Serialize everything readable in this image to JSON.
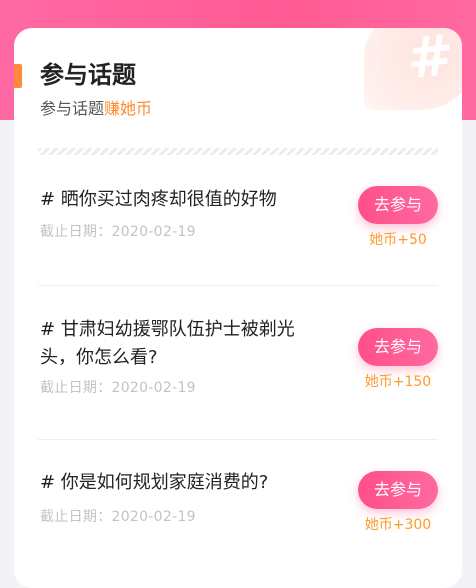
{
  "header": {
    "title": "参与话题",
    "subtitle_prefix": "参与话题",
    "subtitle_highlight": "赚她币",
    "badge_icon": "hash-icon"
  },
  "topics": [
    {
      "title": "# 晒你买过肉疼却很值的好物",
      "date": "截止日期：2020-02-19",
      "button_label": "去参与",
      "reward": "她币+50"
    },
    {
      "title": "# 甘肃妇幼援鄂队伍护士被剃光头，你怎么看?",
      "date": "截止日期：2020-02-19",
      "button_label": "去参与",
      "reward": "她币+150"
    },
    {
      "title": "# 你是如何规划家庭消费的?",
      "date": "截止日期：2020-02-19",
      "button_label": "去参与",
      "reward": "她币+300"
    }
  ],
  "colors": {
    "brand_pink": "#ff5a93",
    "accent_orange": "#ff8a2a"
  }
}
